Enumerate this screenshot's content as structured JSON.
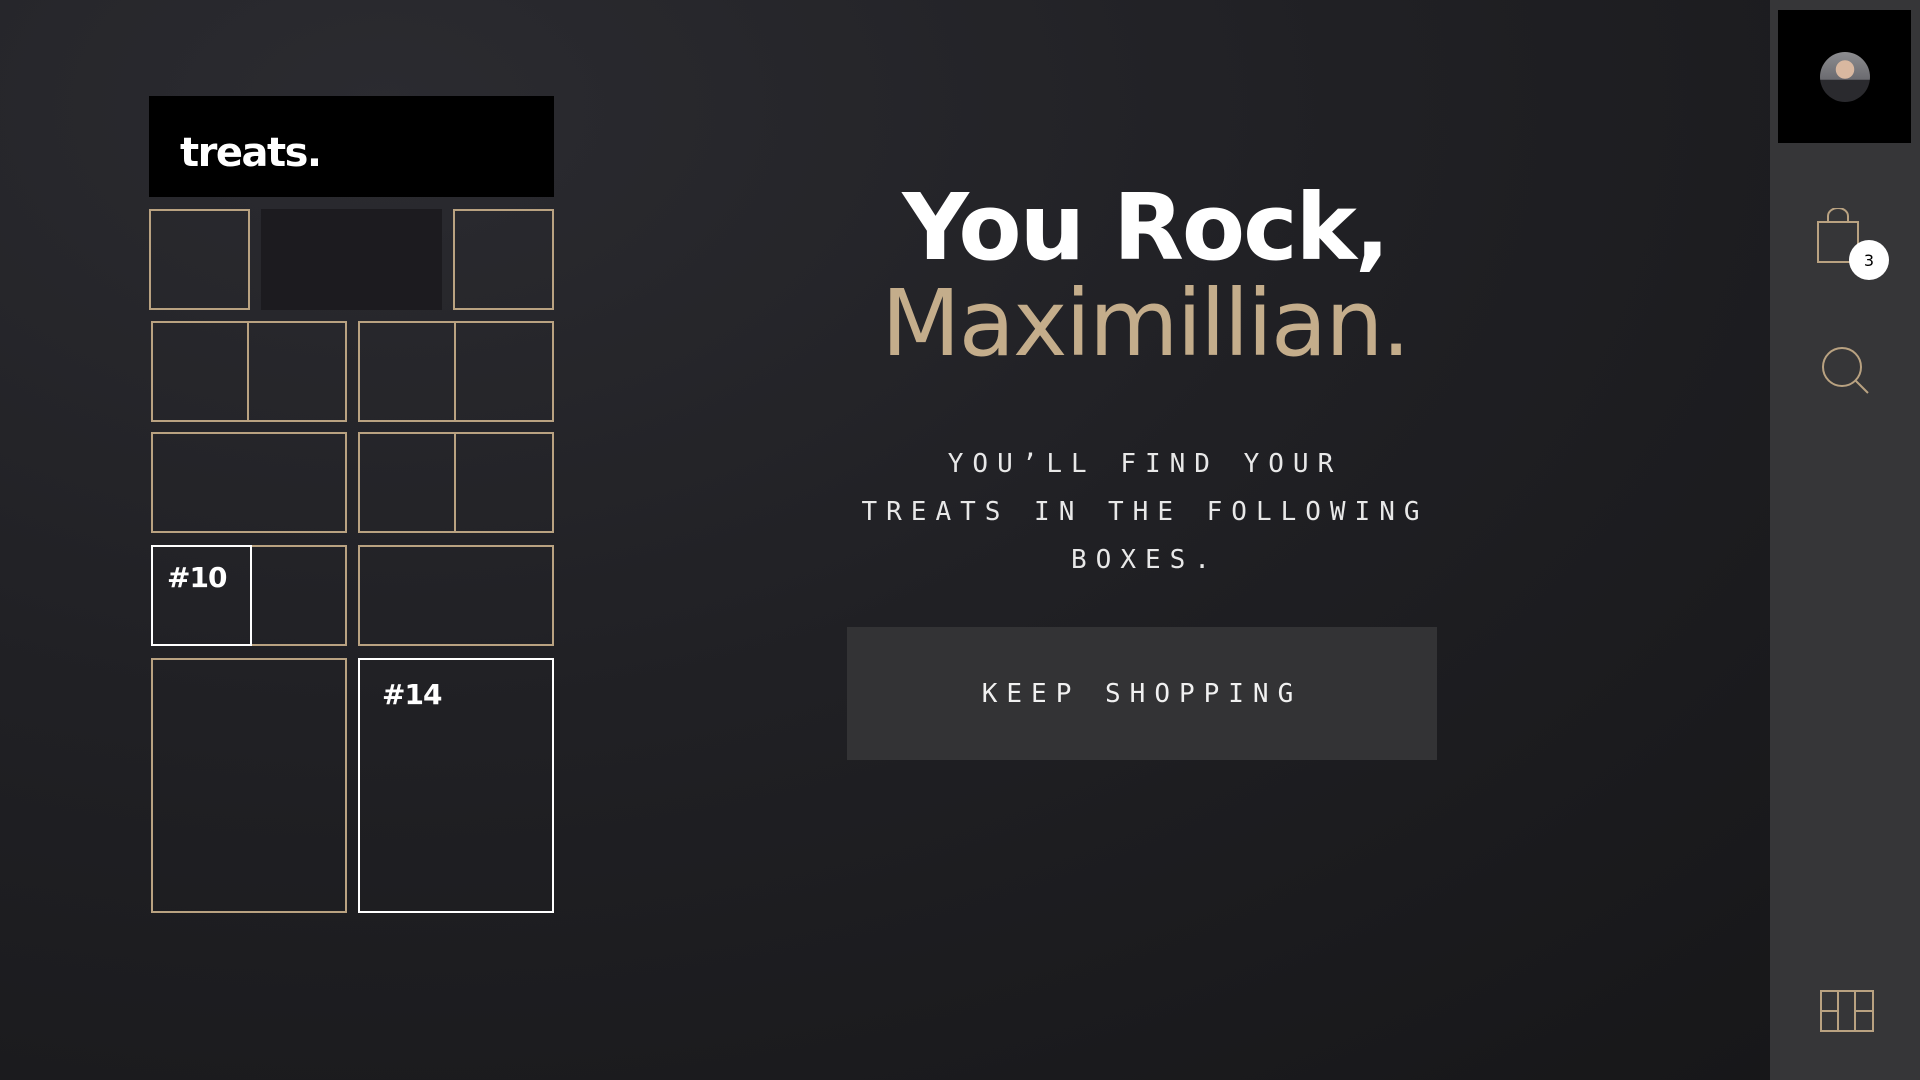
{
  "brand": {
    "name": "treats."
  },
  "locker": {
    "boxes": [
      {
        "id": "box-a"
      },
      {
        "id": "box-b"
      },
      {
        "id": "box-c"
      },
      {
        "id": "box-d"
      },
      {
        "id": "box-e"
      },
      {
        "id": "box-f"
      },
      {
        "id": "box-g"
      },
      {
        "id": "box-h"
      },
      {
        "id": "box-10",
        "label": "#10"
      },
      {
        "id": "box-i"
      },
      {
        "id": "box-j"
      },
      {
        "id": "box-14",
        "label": "#14"
      }
    ],
    "selected_labels": {
      "first": "#10",
      "second": "#14"
    }
  },
  "hero": {
    "greeting": "You Rock,",
    "name": "Maximillian."
  },
  "subtitle": {
    "line1": "YOU’LL FIND YOUR",
    "line2": "TREATS IN THE FOLLOWING BOXES."
  },
  "cta": {
    "label": "KEEP SHOPPING"
  },
  "rail": {
    "cart_count": "3",
    "icons": [
      "avatar",
      "shopping-bag-icon",
      "search-icon",
      "locker-grid-icon"
    ]
  },
  "colors": {
    "accent": "#c4ad8b",
    "box_border": "#b9a281",
    "rail_bg": "#363638",
    "cta_bg": "#333335"
  }
}
